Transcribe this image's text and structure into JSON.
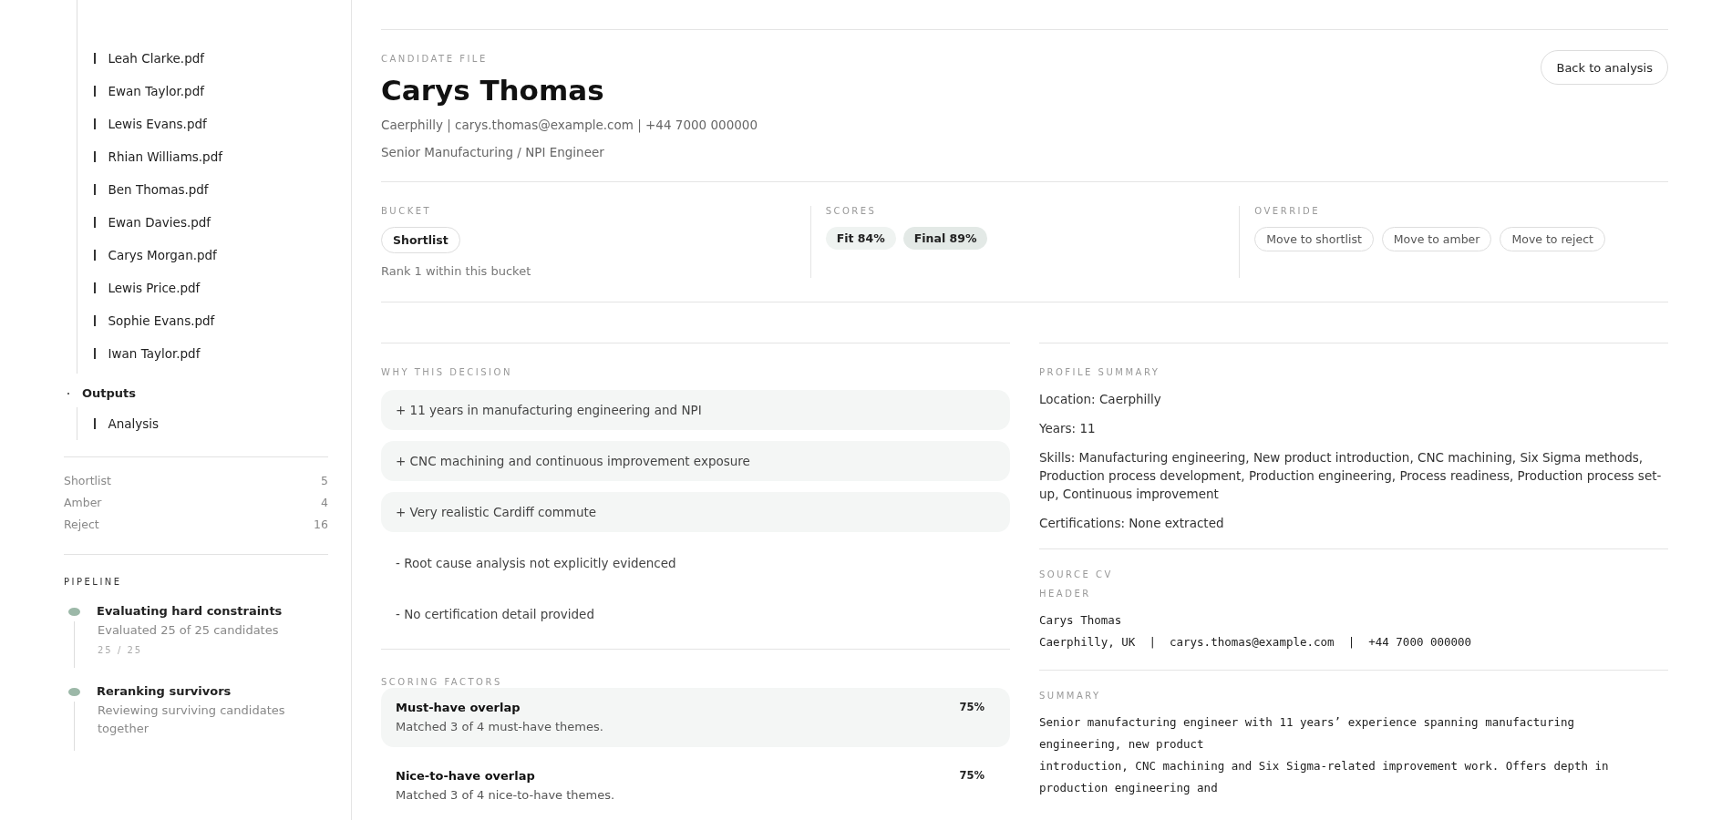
{
  "sidebar": {
    "files": [
      "Leah Clarke.pdf",
      "Ewan Taylor.pdf",
      "Lewis Evans.pdf",
      "Rhian Williams.pdf",
      "Ben Thomas.pdf",
      "Ewan Davies.pdf",
      "Carys Morgan.pdf",
      "Lewis Price.pdf",
      "Sophie Evans.pdf",
      "Iwan Taylor.pdf"
    ],
    "outputs": {
      "label": "Outputs",
      "children": [
        "Analysis"
      ]
    },
    "counts": [
      {
        "label": "Shortlist",
        "value": "5"
      },
      {
        "label": "Amber",
        "value": "4"
      },
      {
        "label": "Reject",
        "value": "16"
      }
    ],
    "pipeline": {
      "title": "PIPELINE",
      "steps": [
        {
          "title": "Evaluating hard constraints",
          "detail": "Evaluated 25 of 25 candidates",
          "progress": "25 / 25"
        },
        {
          "title": "Reranking survivors",
          "detail": "Reviewing surviving candidates together"
        }
      ]
    }
  },
  "header": {
    "eyebrow": "CANDIDATE FILE",
    "name": "Carys Thomas",
    "contact": "Caerphilly | carys.thomas@example.com | +44 7000 000000",
    "role": "Senior Manufacturing / NPI Engineer",
    "back_button": "Back to analysis"
  },
  "bucket": {
    "title": "BUCKET",
    "value": "Shortlist",
    "rank": "Rank 1 within this bucket"
  },
  "scores": {
    "title": "SCORES",
    "chips": [
      {
        "label": "Fit 84%",
        "kind": "fit"
      },
      {
        "label": "Final 89%",
        "kind": "final"
      }
    ]
  },
  "override": {
    "title": "OVERRIDE",
    "buttons": [
      "Move to shortlist",
      "Move to amber",
      "Move to reject"
    ]
  },
  "decision": {
    "title": "WHY THIS DECISION",
    "items": [
      {
        "text": "+ 11 years in manufacturing engineering and NPI",
        "kind": "pro"
      },
      {
        "text": "+ CNC machining and continuous improvement exposure",
        "kind": "pro"
      },
      {
        "text": "+ Very realistic Cardiff commute",
        "kind": "pro"
      },
      {
        "text": "- Root cause analysis not explicitly evidenced",
        "kind": "con"
      },
      {
        "text": "- No certification detail provided",
        "kind": "con"
      }
    ]
  },
  "scoring": {
    "title": "SCORING FACTORS",
    "factors": [
      {
        "name": "Must-have overlap",
        "detail": "Matched 3 of 4 must-have themes.",
        "value": "75%",
        "kind": "card"
      },
      {
        "name": "Nice-to-have overlap",
        "detail": "Matched 3 of 4 nice-to-have themes.",
        "value": "75%",
        "kind": "plain"
      }
    ]
  },
  "profile": {
    "title": "PROFILE SUMMARY",
    "lines": [
      "Location: Caerphilly",
      "Years: 11",
      "Skills: Manufacturing engineering, New product introduction, CNC machining, Six Sigma methods, Production process development, Production engineering, Process readiness, Production process set-up, Continuous improvement",
      "Certifications: None extracted"
    ]
  },
  "source_cv": {
    "title": "SOURCE CV",
    "header_title": "HEADER",
    "header_lines": [
      "Carys Thomas",
      "Caerphilly, UK  |  carys.thomas@example.com  |  +44 7000 000000"
    ],
    "summary_title": "SUMMARY",
    "summary_lines": [
      "Senior manufacturing engineer with 11 years’ experience spanning manufacturing engineering, new product",
      "introduction, CNC machining and Six Sigma-related improvement work. Offers depth in production engineering and"
    ]
  }
}
